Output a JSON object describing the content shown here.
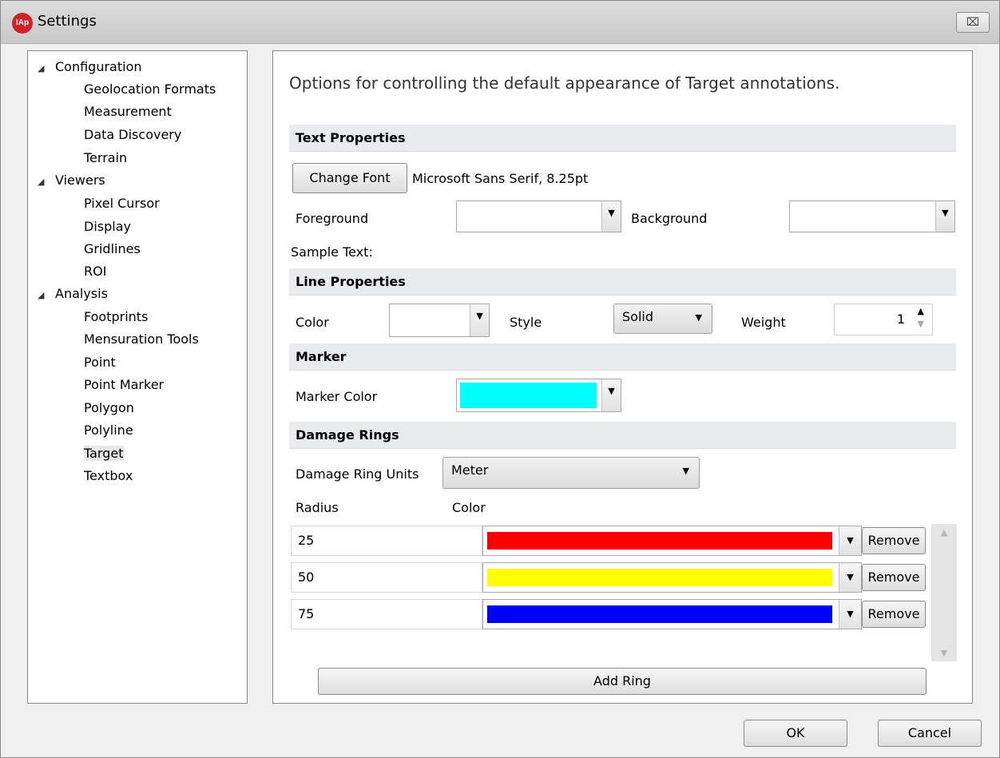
{
  "window": {
    "title": "Settings",
    "close_label": "⌧",
    "icon_text": "IAp"
  },
  "tree": {
    "groups": [
      {
        "label": "Configuration",
        "items": [
          "Geolocation Formats",
          "Measurement",
          "Data Discovery",
          "Terrain"
        ]
      },
      {
        "label": "Viewers",
        "items": [
          "Pixel Cursor",
          "Display",
          "Gridlines",
          "ROI"
        ]
      },
      {
        "label": "Analysis",
        "items": [
          "Footprints",
          "Mensuration Tools",
          "Point",
          "Point Marker",
          "Polygon",
          "Polyline",
          "Target",
          "Textbox"
        ]
      }
    ],
    "selected": "Target"
  },
  "content": {
    "description": "Options for controlling the default appearance of Target annotations.",
    "text_properties": {
      "header": "Text Properties",
      "change_font_label": "Change Font",
      "font_value": "Microsoft Sans Serif, 8.25pt",
      "foreground_label": "Foreground",
      "background_label": "Background",
      "sample_text_label": "Sample Text:"
    },
    "line_properties": {
      "header": "Line Properties",
      "color_label": "Color",
      "style_label": "Style",
      "style_value": "Solid",
      "weight_label": "Weight",
      "weight_value": "1"
    },
    "marker": {
      "header": "Marker",
      "marker_color_label": "Marker Color",
      "marker_color": "#00ffff"
    },
    "damage_rings": {
      "header": "Damage Rings",
      "units_label": "Damage Ring Units",
      "units_value": "Meter",
      "radius_col": "Radius",
      "color_col": "Color",
      "rows": [
        {
          "radius": "25",
          "color": "#ff0000",
          "remove_label": "Remove"
        },
        {
          "radius": "50",
          "color": "#ffff00",
          "remove_label": "Remove"
        },
        {
          "radius": "75",
          "color": "#0000ff",
          "remove_label": "Remove"
        }
      ],
      "add_ring_label": "Add Ring"
    }
  },
  "footer": {
    "ok_label": "OK",
    "cancel_label": "Cancel"
  }
}
